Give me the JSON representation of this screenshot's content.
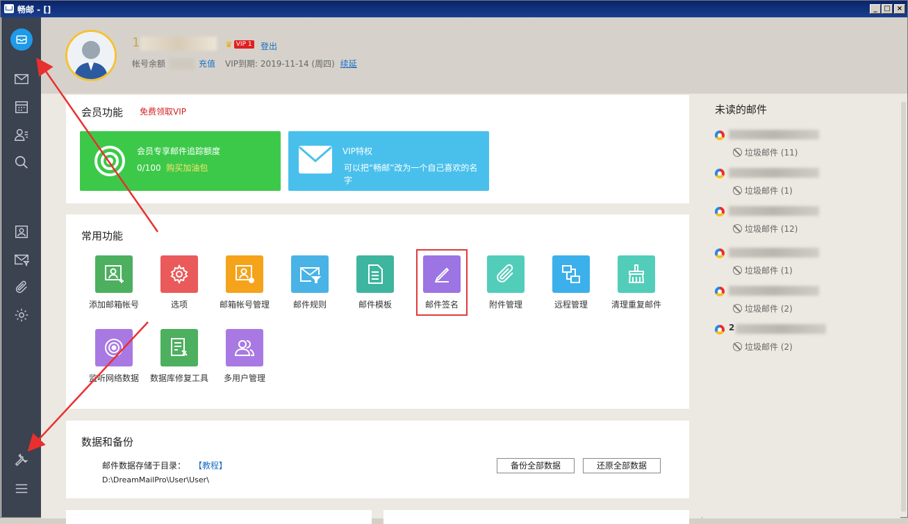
{
  "window": {
    "title": "畅邮 - []",
    "min_label": "_",
    "max_label": "□",
    "close_label": "×"
  },
  "sidebar": {
    "items": [
      {
        "name": "mail-home",
        "icon": "mail-circle-icon"
      },
      {
        "name": "inbox",
        "icon": "envelope-icon"
      },
      {
        "name": "calendar",
        "icon": "calendar-icon"
      },
      {
        "name": "contacts",
        "icon": "contacts-icon"
      },
      {
        "name": "search",
        "icon": "search-icon"
      },
      {
        "name": "account",
        "icon": "person-card-icon"
      },
      {
        "name": "mail-rules",
        "icon": "mail-filter-icon"
      },
      {
        "name": "attachments",
        "icon": "paperclip-icon"
      },
      {
        "name": "settings",
        "icon": "gear-icon"
      },
      {
        "name": "tools",
        "icon": "wrench-icon"
      },
      {
        "name": "menu",
        "icon": "hamburger-icon"
      }
    ]
  },
  "header": {
    "username_prefix": "1",
    "vip_badge": "VIP 1",
    "logout": "登出",
    "balance_label": "帐号余额",
    "recharge": "充值",
    "vip_expire_label": "VIP到期: 2019-11-14 (周四)",
    "renew": "续延"
  },
  "member": {
    "title": "会员功能",
    "free_vip": "免费领取VIP",
    "tracking_card": {
      "title": "会员专享邮件追踪额度",
      "quota": "0/100",
      "buy_link": "购买加油包",
      "color": "#3cc94a"
    },
    "vip_card": {
      "title": "VIP特权",
      "desc": "可以把“畅邮”改为一个自己喜欢的名字",
      "color": "#49c0ec"
    }
  },
  "common": {
    "title": "常用功能",
    "items": [
      {
        "label": "添加邮箱帐号",
        "color": "#4cb05f",
        "icon": "add-account-icon"
      },
      {
        "label": "选项",
        "color": "#ea5a5a",
        "icon": "gear-icon"
      },
      {
        "label": "邮箱帐号管理",
        "color": "#f5a31a",
        "icon": "account-settings-icon"
      },
      {
        "label": "邮件规则",
        "color": "#49b3e6",
        "icon": "mail-filter-icon"
      },
      {
        "label": "邮件模板",
        "color": "#3eb59f",
        "icon": "document-icon"
      },
      {
        "label": "邮件签名",
        "color": "#9c74e3",
        "icon": "pen-icon"
      },
      {
        "label": "附件管理",
        "color": "#52cdb9",
        "icon": "paperclip-icon"
      },
      {
        "label": "远程管理",
        "color": "#3cb0ea",
        "icon": "remote-icon"
      },
      {
        "label": "清理重复邮件",
        "color": "#52cdb9",
        "icon": "broom-icon"
      },
      {
        "label": "监听网络数据",
        "color": "#a979e3",
        "icon": "radar-icon"
      },
      {
        "label": "数据库修复工具",
        "color": "#4cb05f",
        "icon": "database-repair-icon"
      },
      {
        "label": "多用户管理",
        "color": "#a979e3",
        "icon": "multi-user-icon"
      }
    ]
  },
  "backup": {
    "title": "数据和备份",
    "storage_label": "邮件数据存储于目录：",
    "tutorial": "【教程】",
    "path": "D:\\DreamMailPro\\User\\User\\",
    "backup_button": "备份全部数据",
    "restore_button": "还原全部数据"
  },
  "unread": {
    "title": "未读的邮件",
    "items": [
      {
        "first_char": "",
        "folder": "垃圾邮件 (11)"
      },
      {
        "first_char": "",
        "folder": "垃圾邮件 (1)"
      },
      {
        "first_char": "",
        "folder": "垃圾邮件 (12)"
      },
      {
        "first_char": "",
        "folder": "垃圾邮件 (1)"
      },
      {
        "first_char": "",
        "folder": "垃圾邮件 (2)"
      },
      {
        "first_char": "2",
        "folder": "垃圾邮件 (2)"
      }
    ]
  },
  "colors": {
    "sidebar": "#3b4250",
    "accent": "#1e9be8",
    "highlight": "#e03a3a"
  }
}
